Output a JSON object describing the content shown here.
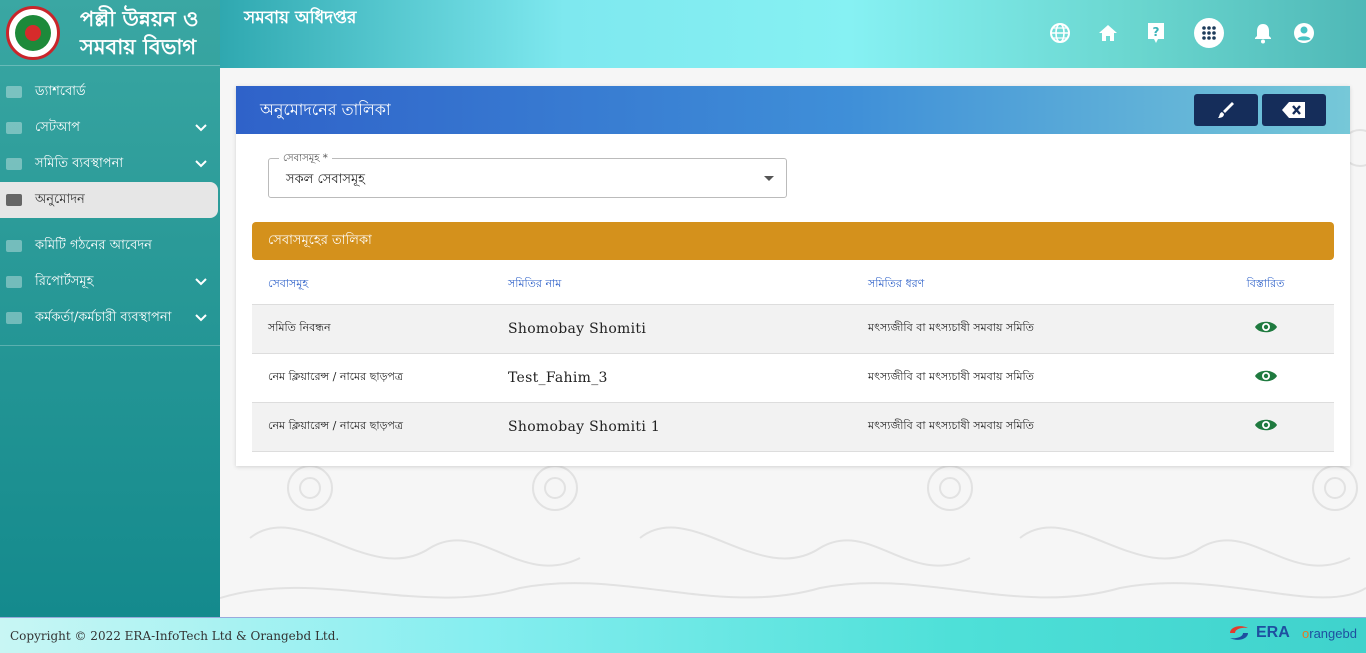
{
  "brand": {
    "title_line1": "পল্লী উন্নয়ন ও",
    "title_line2": "সমবায় বিভাগ"
  },
  "header": {
    "title": "সমবায় অধিদপ্তর",
    "icons": [
      "globe-icon",
      "home-icon",
      "help-icon",
      "apps-icon",
      "bell-icon",
      "account-icon"
    ]
  },
  "sidebar": {
    "items": [
      {
        "label": "ড্যাশবোর্ড",
        "expandable": false
      },
      {
        "label": "সেটআপ",
        "expandable": true
      },
      {
        "label": "সমিতি ব্যবস্থাপনা",
        "expandable": true
      },
      {
        "label": "অনুমোদন",
        "expandable": false,
        "active": true
      },
      {
        "label": "কমিটি গঠনের আবেদন",
        "expandable": false
      },
      {
        "label": "রিপোর্টসমূহ",
        "expandable": true
      },
      {
        "label": "কর্মকর্তা/কর্মচারী ব্যবস্থাপনা",
        "expandable": true
      }
    ]
  },
  "card": {
    "title": "অনুমোদনের তালিকা",
    "field_label": "সেবাসমূহ *",
    "field_value": "সকল সেবাসমূহ",
    "table_title": "সেবাসমূহের তালিকা",
    "columns": [
      "সেবাসমূহ",
      "সমিতির নাম",
      "সমিতির ধরণ",
      "বিস্তারিত"
    ],
    "rows": [
      {
        "service": "সমিতি নিবন্ধন",
        "name": "Shomobay Shomiti",
        "type": "মৎস্যজীবি বা মৎস্যচাষী সমবায় সমিতি"
      },
      {
        "service": "নেম ক্লিয়ারেন্স / নামের ছাড়পত্র",
        "name": "Test_Fahim_3",
        "type": "মৎস্যজীবি বা মৎস্যচাষী সমবায় সমিতি"
      },
      {
        "service": "নেম ক্লিয়ারেন্স / নামের ছাড়পত্র",
        "name": "Shomobay Shomiti 1",
        "type": "মৎস্যজীবি বা মৎস্যচাষী সমবায় সমিতি"
      }
    ]
  },
  "footer": {
    "copyright": "Copyright © 2022 ERA-InfoTech Ltd & Orangebd Ltd.",
    "era_logo": "ERA",
    "orange_logo_prefix": "o",
    "orange_logo_rest": "rangebd"
  },
  "colors": {
    "accent_blue": "#2f62c9",
    "table_title_bg": "#d4911c",
    "eye_green": "#1f7a3f",
    "button_navy": "#152d5a"
  }
}
